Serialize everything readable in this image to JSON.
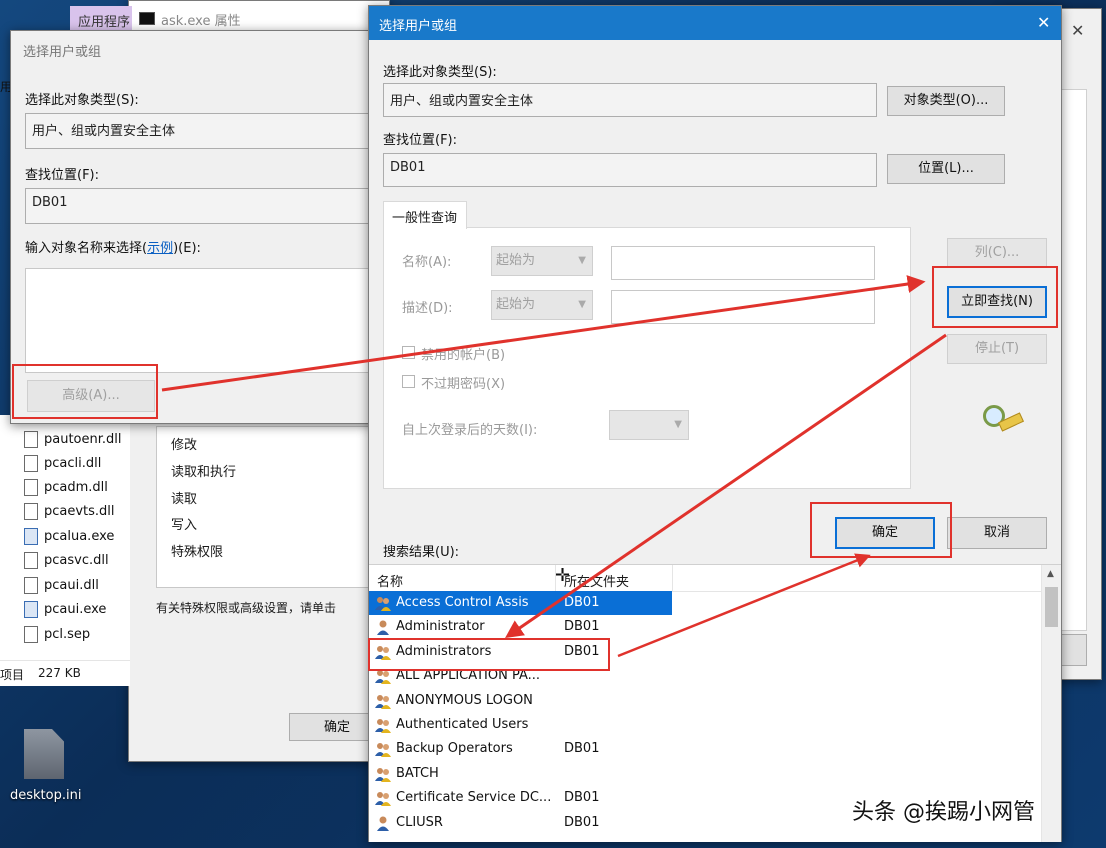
{
  "colors": {
    "accent": "#0a6fd6",
    "highlight": "#e0322c",
    "titlebar_active": "#1979ca",
    "desktop": "#0b2d57"
  },
  "back_window": {
    "tab_label": "应用程序",
    "title": "ask.exe 属性"
  },
  "left_dialog": {
    "title": "选择用户或组",
    "object_type_label": "选择此对象类型(S):",
    "object_type_value": "用户、组或内置安全主体",
    "location_label": "查找位置(F):",
    "location_value": "DB01",
    "enter_names_label": "输入对象名称来选择(",
    "examples_link": "示例",
    "enter_names_suffix": ")(E):",
    "advanced_button": "高级(A)...",
    "ok_button": "确定"
  },
  "explorer": {
    "letter": "用",
    "files": [
      {
        "name": "pautoenr.dll",
        "type": "dll"
      },
      {
        "name": "pcacli.dll",
        "type": "dll"
      },
      {
        "name": "pcadm.dll",
        "type": "dll"
      },
      {
        "name": "pcaevts.dll",
        "type": "dll"
      },
      {
        "name": "pcalua.exe",
        "type": "exe"
      },
      {
        "name": "pcasvc.dll",
        "type": "dll"
      },
      {
        "name": "pcaui.dll",
        "type": "dll"
      },
      {
        "name": "pcaui.exe",
        "type": "exe"
      },
      {
        "name": "pcl.sep",
        "type": "file"
      }
    ],
    "status_items": "项目",
    "status_size": "227 KB"
  },
  "permissions": {
    "items": [
      "修改",
      "读取和执行",
      "读取",
      "写入",
      "特殊权限"
    ],
    "footer": "有关特殊权限或高级设置，请单击"
  },
  "desktop_icon": {
    "label": "desktop.ini"
  },
  "main_dialog": {
    "title": "选择用户或组",
    "close_glyph": "✕",
    "object_type_label": "选择此对象类型(S):",
    "object_type_value": "用户、组或内置安全主体",
    "object_types_button": "对象类型(O)...",
    "location_label": "查找位置(F):",
    "location_value": "DB01",
    "locations_button": "位置(L)...",
    "tab_common_queries": "一般性查询",
    "name_label": "名称(A):",
    "name_mode": "起始为",
    "desc_label": "描述(D):",
    "desc_mode": "起始为",
    "disabled_accounts": "禁用的帐户(B)",
    "non_expiring_password": "不过期密码(X)",
    "days_since_logon": "自上次登录后的天数(I):",
    "columns_button": "列(C)...",
    "find_now_button": "立即查找(N)",
    "stop_button": "停止(T)",
    "ok_button": "确定",
    "cancel_button": "取消",
    "search_results_label": "搜索结果(U):",
    "col_name": "名称",
    "col_folder": "所在文件夹",
    "results": [
      {
        "name": "Access Control Assis",
        "folder": "DB01",
        "icon": "group",
        "selected": true
      },
      {
        "name": "Administrator",
        "folder": "DB01",
        "icon": "user",
        "selected": false
      },
      {
        "name": "Administrators",
        "folder": "DB01",
        "icon": "group",
        "selected": false
      },
      {
        "name": "ALL APPLICATION PA...",
        "folder": "",
        "icon": "group",
        "selected": false
      },
      {
        "name": "ANONYMOUS LOGON",
        "folder": "",
        "icon": "group",
        "selected": false
      },
      {
        "name": "Authenticated Users",
        "folder": "",
        "icon": "group",
        "selected": false
      },
      {
        "name": "Backup Operators",
        "folder": "DB01",
        "icon": "group",
        "selected": false
      },
      {
        "name": "BATCH",
        "folder": "",
        "icon": "group",
        "selected": false
      },
      {
        "name": "Certificate Service DC...",
        "folder": "DB01",
        "icon": "group",
        "selected": false
      },
      {
        "name": "CLIUSR",
        "folder": "DB01",
        "icon": "user",
        "selected": false
      }
    ]
  },
  "right_window": {
    "close_glyph": "✕"
  },
  "watermark": {
    "text": "头条 @挨踢小网管"
  }
}
